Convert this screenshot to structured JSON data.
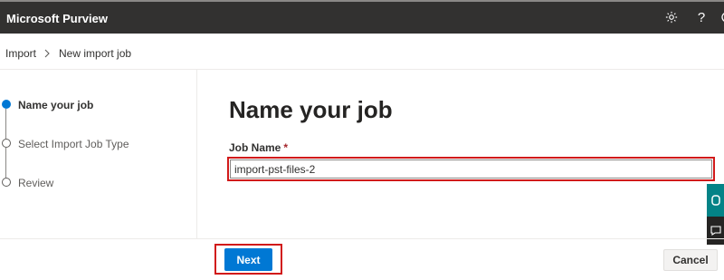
{
  "header": {
    "app_title": "Microsoft Purview",
    "icons": [
      "gear-icon",
      "help-icon",
      "more-icon"
    ],
    "background": "#323130"
  },
  "breadcrumb": {
    "items": [
      "Import",
      "New import job"
    ]
  },
  "wizard": {
    "steps": [
      {
        "label": "Name your job",
        "state": "active"
      },
      {
        "label": "Select Import Job Type",
        "state": "pending"
      },
      {
        "label": "Review",
        "state": "pending"
      }
    ],
    "accent": "#0078d4"
  },
  "main": {
    "title": "Name your job",
    "field_label": "Job Name",
    "required_mark": "*",
    "job_name_value": "import-pst-files-2"
  },
  "side_tabs": {
    "icons": [
      "feedback-icon",
      "chat-icon"
    ]
  },
  "footer": {
    "next_label": "Next",
    "cancel_label": "Cancel"
  }
}
